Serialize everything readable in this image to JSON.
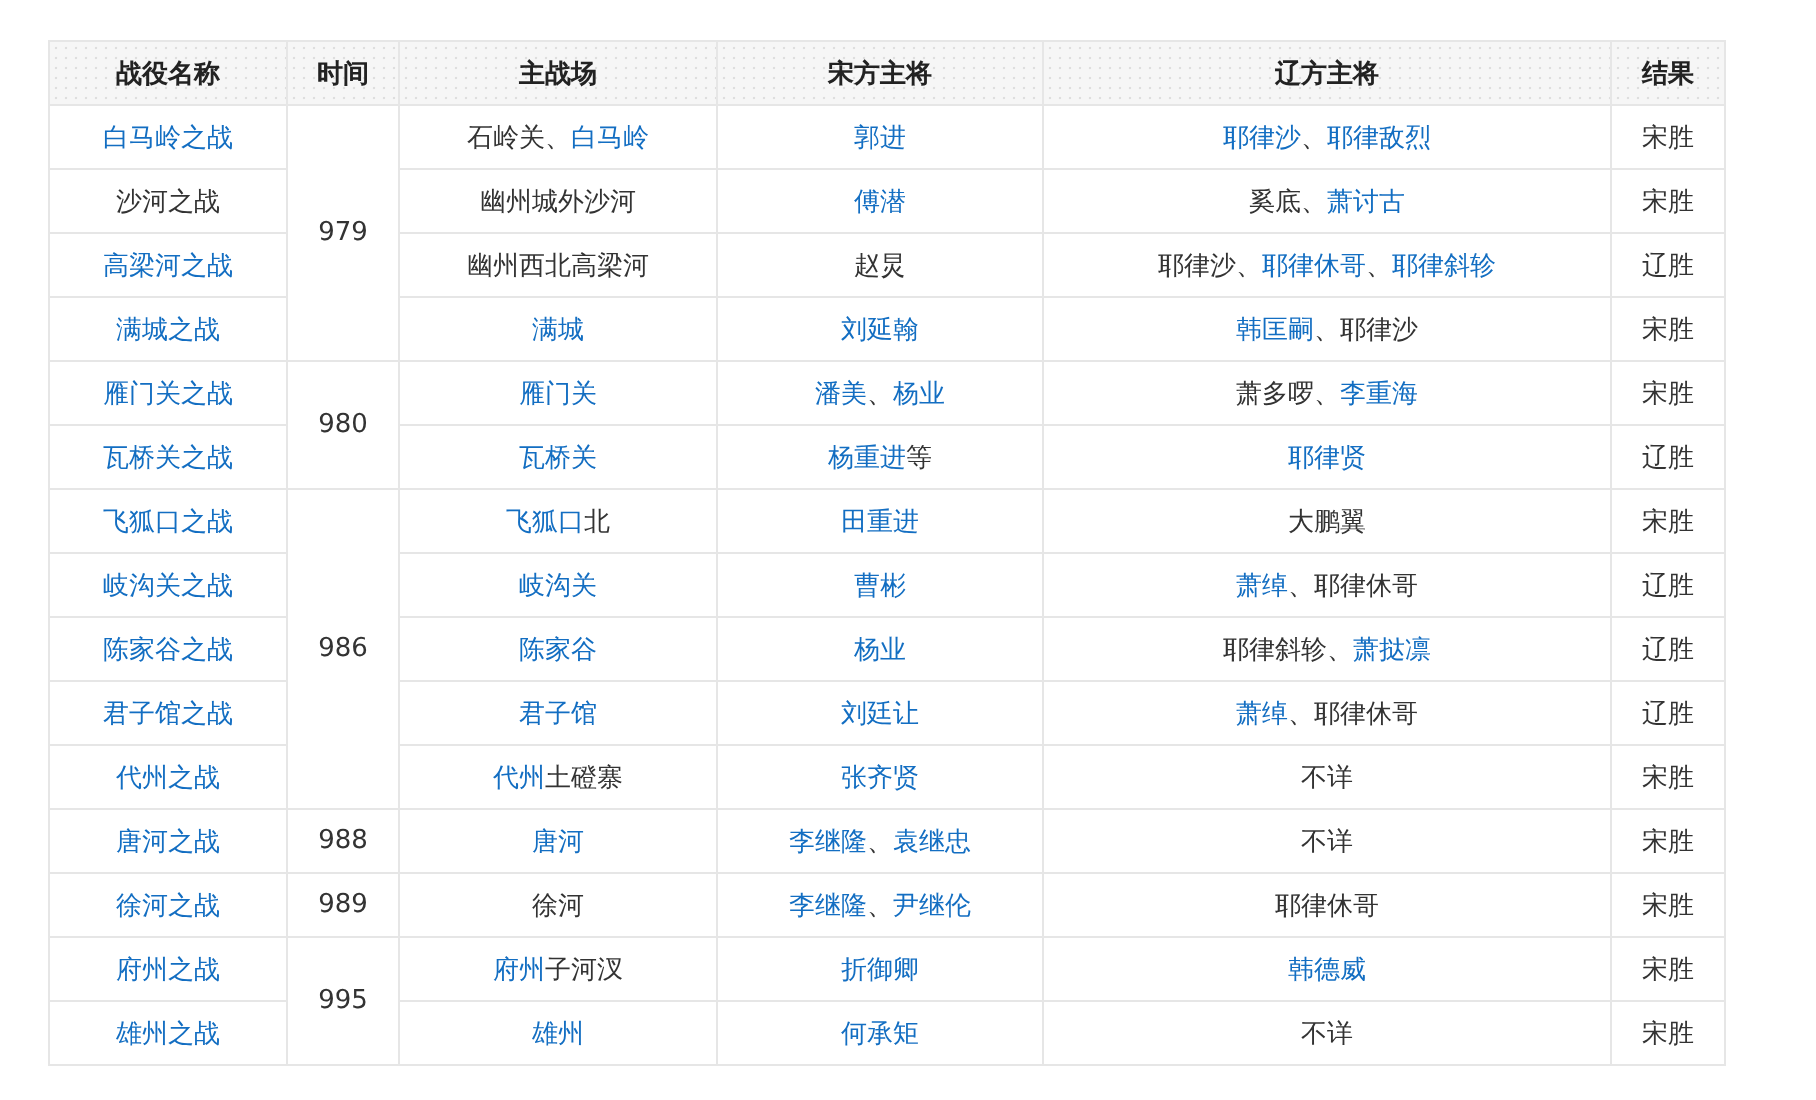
{
  "table": {
    "columns": [
      "战役名称",
      "时间",
      "主战场",
      "宋方主将",
      "辽方主将",
      "结果"
    ],
    "groups": [
      {
        "year": "979",
        "battles": [
          {
            "name": [
              {
                "text": "白马岭之战",
                "link": true
              }
            ],
            "battlefield": [
              {
                "text": "石岭关、",
                "link": false
              },
              {
                "text": "白马岭",
                "link": true
              }
            ],
            "song_commanders": [
              {
                "text": "郭进",
                "link": true
              }
            ],
            "liao_commanders": [
              {
                "text": "耶律沙",
                "link": true
              },
              {
                "text": "、",
                "link": false
              },
              {
                "text": "耶律敌烈",
                "link": true
              }
            ],
            "result": "宋胜"
          },
          {
            "name": [
              {
                "text": "沙河之战",
                "link": false
              }
            ],
            "battlefield": [
              {
                "text": "幽州城外沙河",
                "link": false
              }
            ],
            "song_commanders": [
              {
                "text": "傅潜",
                "link": true
              }
            ],
            "liao_commanders": [
              {
                "text": "奚底、",
                "link": false
              },
              {
                "text": "萧讨古",
                "link": true
              }
            ],
            "result": "宋胜"
          },
          {
            "name": [
              {
                "text": "高梁河之战",
                "link": true
              }
            ],
            "battlefield": [
              {
                "text": "幽州西北高梁河",
                "link": false
              }
            ],
            "song_commanders": [
              {
                "text": "赵炅",
                "link": false
              }
            ],
            "liao_commanders": [
              {
                "text": "耶律沙、",
                "link": false
              },
              {
                "text": "耶律休哥",
                "link": true
              },
              {
                "text": "、",
                "link": false
              },
              {
                "text": "耶律斜轸",
                "link": true
              }
            ],
            "result": "辽胜"
          },
          {
            "name": [
              {
                "text": "满城之战",
                "link": true
              }
            ],
            "battlefield": [
              {
                "text": "满城",
                "link": true
              }
            ],
            "song_commanders": [
              {
                "text": "刘延翰",
                "link": true
              }
            ],
            "liao_commanders": [
              {
                "text": "韩匡嗣",
                "link": true
              },
              {
                "text": "、耶律沙",
                "link": false
              }
            ],
            "result": "宋胜"
          }
        ]
      },
      {
        "year": "980",
        "battles": [
          {
            "name": [
              {
                "text": "雁门关之战",
                "link": true
              }
            ],
            "battlefield": [
              {
                "text": "雁门关",
                "link": true
              }
            ],
            "song_commanders": [
              {
                "text": "潘美",
                "link": true
              },
              {
                "text": "、",
                "link": false
              },
              {
                "text": "杨业",
                "link": true
              }
            ],
            "liao_commanders": [
              {
                "text": "萧多啰、",
                "link": false
              },
              {
                "text": "李重海",
                "link": true
              }
            ],
            "result": "宋胜"
          },
          {
            "name": [
              {
                "text": "瓦桥关之战",
                "link": true
              }
            ],
            "battlefield": [
              {
                "text": "瓦桥关",
                "link": true
              }
            ],
            "song_commanders": [
              {
                "text": "杨重进",
                "link": true
              },
              {
                "text": "等",
                "link": false
              }
            ],
            "liao_commanders": [
              {
                "text": "耶律贤",
                "link": true
              }
            ],
            "result": "辽胜"
          }
        ]
      },
      {
        "year": "986",
        "battles": [
          {
            "name": [
              {
                "text": "飞狐口之战",
                "link": true
              }
            ],
            "battlefield": [
              {
                "text": "飞狐口",
                "link": true
              },
              {
                "text": "北",
                "link": false
              }
            ],
            "song_commanders": [
              {
                "text": "田重进",
                "link": true
              }
            ],
            "liao_commanders": [
              {
                "text": "大鹏翼",
                "link": false
              }
            ],
            "result": "宋胜"
          },
          {
            "name": [
              {
                "text": "岐沟关之战",
                "link": true
              }
            ],
            "battlefield": [
              {
                "text": "岐沟关",
                "link": true
              }
            ],
            "song_commanders": [
              {
                "text": "曹彬",
                "link": true
              }
            ],
            "liao_commanders": [
              {
                "text": "萧绰",
                "link": true
              },
              {
                "text": "、耶律休哥",
                "link": false
              }
            ],
            "result": "辽胜"
          },
          {
            "name": [
              {
                "text": "陈家谷之战",
                "link": true
              }
            ],
            "battlefield": [
              {
                "text": "陈家谷",
                "link": true
              }
            ],
            "song_commanders": [
              {
                "text": "杨业",
                "link": true
              }
            ],
            "liao_commanders": [
              {
                "text": "耶律斜轸、",
                "link": false
              },
              {
                "text": "萧挞凛",
                "link": true
              }
            ],
            "result": "辽胜"
          },
          {
            "name": [
              {
                "text": "君子馆之战",
                "link": true
              }
            ],
            "battlefield": [
              {
                "text": "君子馆",
                "link": true
              }
            ],
            "song_commanders": [
              {
                "text": "刘廷让",
                "link": true
              }
            ],
            "liao_commanders": [
              {
                "text": "萧绰",
                "link": true
              },
              {
                "text": "、耶律休哥",
                "link": false
              }
            ],
            "result": "辽胜"
          },
          {
            "name": [
              {
                "text": "代州之战",
                "link": true
              }
            ],
            "battlefield": [
              {
                "text": "代州",
                "link": true
              },
              {
                "text": "土磴寨",
                "link": false
              }
            ],
            "song_commanders": [
              {
                "text": "张齐贤",
                "link": true
              }
            ],
            "liao_commanders": [
              {
                "text": "不详",
                "link": false
              }
            ],
            "result": "宋胜"
          }
        ]
      },
      {
        "year": "988",
        "battles": [
          {
            "name": [
              {
                "text": "唐河之战",
                "link": true
              }
            ],
            "battlefield": [
              {
                "text": "唐河",
                "link": true
              }
            ],
            "song_commanders": [
              {
                "text": "李继隆",
                "link": true
              },
              {
                "text": "、",
                "link": false
              },
              {
                "text": "袁继忠",
                "link": true
              }
            ],
            "liao_commanders": [
              {
                "text": "不详",
                "link": false
              }
            ],
            "result": "宋胜"
          }
        ]
      },
      {
        "year": "989",
        "battles": [
          {
            "name": [
              {
                "text": "徐河之战",
                "link": true
              }
            ],
            "battlefield": [
              {
                "text": "徐河",
                "link": false
              }
            ],
            "song_commanders": [
              {
                "text": "李继隆",
                "link": true
              },
              {
                "text": "、",
                "link": false
              },
              {
                "text": "尹继伦",
                "link": true
              }
            ],
            "liao_commanders": [
              {
                "text": "耶律休哥",
                "link": false
              }
            ],
            "result": "宋胜"
          }
        ]
      },
      {
        "year": "995",
        "battles": [
          {
            "name": [
              {
                "text": "府州之战",
                "link": true
              }
            ],
            "battlefield": [
              {
                "text": "府州",
                "link": true
              },
              {
                "text": "子河汊",
                "link": false
              }
            ],
            "song_commanders": [
              {
                "text": "折御卿",
                "link": true
              }
            ],
            "liao_commanders": [
              {
                "text": "韩德威",
                "link": true
              }
            ],
            "result": "宋胜"
          },
          {
            "name": [
              {
                "text": "雄州之战",
                "link": true
              }
            ],
            "battlefield": [
              {
                "text": "雄州",
                "link": true
              }
            ],
            "song_commanders": [
              {
                "text": "何承矩",
                "link": true
              }
            ],
            "liao_commanders": [
              {
                "text": "不详",
                "link": false
              }
            ],
            "result": "宋胜"
          }
        ]
      }
    ]
  }
}
